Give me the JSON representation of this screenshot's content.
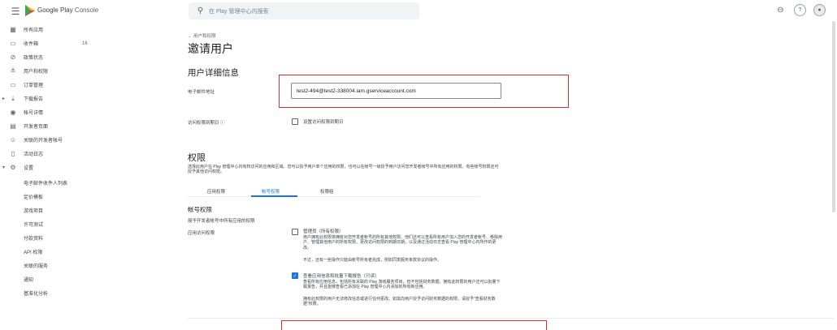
{
  "topbar": {
    "brand_a": "Google Play",
    "brand_b": "Console",
    "search_placeholder": "在 Play 管理中心内搜索",
    "icons": [
      "link-icon",
      "help-icon",
      "account-avatar-icon"
    ]
  },
  "sidebar": {
    "items": [
      {
        "label": "所有应用",
        "icon": "apps-grid-icon"
      },
      {
        "label": "收件箱",
        "icon": "inbox-icon",
        "badge": "16"
      },
      {
        "label": "政策状态",
        "icon": "policy-check-icon"
      },
      {
        "label": "用户和权限",
        "icon": "users-icon"
      },
      {
        "label": "订单管理",
        "icon": "card-icon"
      },
      {
        "label": "下载报告",
        "icon": "download-icon"
      },
      {
        "label": "帐号详情",
        "icon": "account-circle-icon"
      },
      {
        "label": "开发者页面",
        "icon": "page-icon"
      },
      {
        "label": "关联的开发者帐号",
        "icon": "linked-account-icon"
      },
      {
        "label": "活动日志",
        "icon": "log-icon"
      },
      {
        "label": "设置",
        "icon": "gear-icon"
      }
    ],
    "sub_items": [
      "电子邮件收件人列表",
      "定价模板",
      "游戏项目",
      "许可测试",
      "付款资料",
      "API 权限",
      "关联的服务",
      "通知",
      "基准化分析"
    ]
  },
  "main": {
    "back_label": "用户和权限",
    "title": "邀请用户",
    "user_details_heading": "用户详细信息",
    "email_label": "电子邮件地址",
    "email_value": "test2-494@test2-338004.iam.gserviceaccount.com",
    "expiry_label": "访问权限到期日",
    "expiry_checkbox_label": "设置访问权限到期日",
    "permissions_heading": "权限",
    "permissions_desc": "选择此用户在 Play 管理中心内有权访问的应用和区域。您可以授予用户单个应用的权限，也可以在帐号一级授予用户访问您开发者帐号中所有应用的权限。有些帐号权限还可授予其他访问权限。",
    "tabs": [
      "应用权限",
      "帐号权限",
      "权限组"
    ],
    "active_tab": 1,
    "account_perms_heading": "帐号权限",
    "account_perms_sub": "授予开发者帐号中所有应用的权限",
    "app_access_label": "应用访问权限",
    "perm_admin_title": "管理员（所有权限）",
    "perm_admin_desc": "用户拥有此权限将拥有对您开发者帐号的所有其他权限。他们还可以查看所有用户加入您的开发者帐号、移除用户、管理其他用户的所有权限、更改访问权限的到期日期，以及通过活动日志查看 Play 管理中心内所作的更改。",
    "perm_admin_note": "不过，还有一些操作只能由帐号所有者完成，例如同意服务条款协议的操作。",
    "perm_view_title": "查看应用信息和批量下载报告（只读）",
    "perm_view_desc": "查看所有应用信息，包括所有关联的 Play 游戏服务项目，但不包括财务数据。拥有此权限的用户还可以批量下载报告，并且能够查看已添加在 Play 管理中心内添加的所有新应用。",
    "perm_view_note": "拥有此权限的用户无法修改信息或进行任何更改。如需向用户授予访问财务数据的权限，请授予“查看财务数据”权限。",
    "perm_admin_checked": false,
    "perm_view_checked": true
  }
}
